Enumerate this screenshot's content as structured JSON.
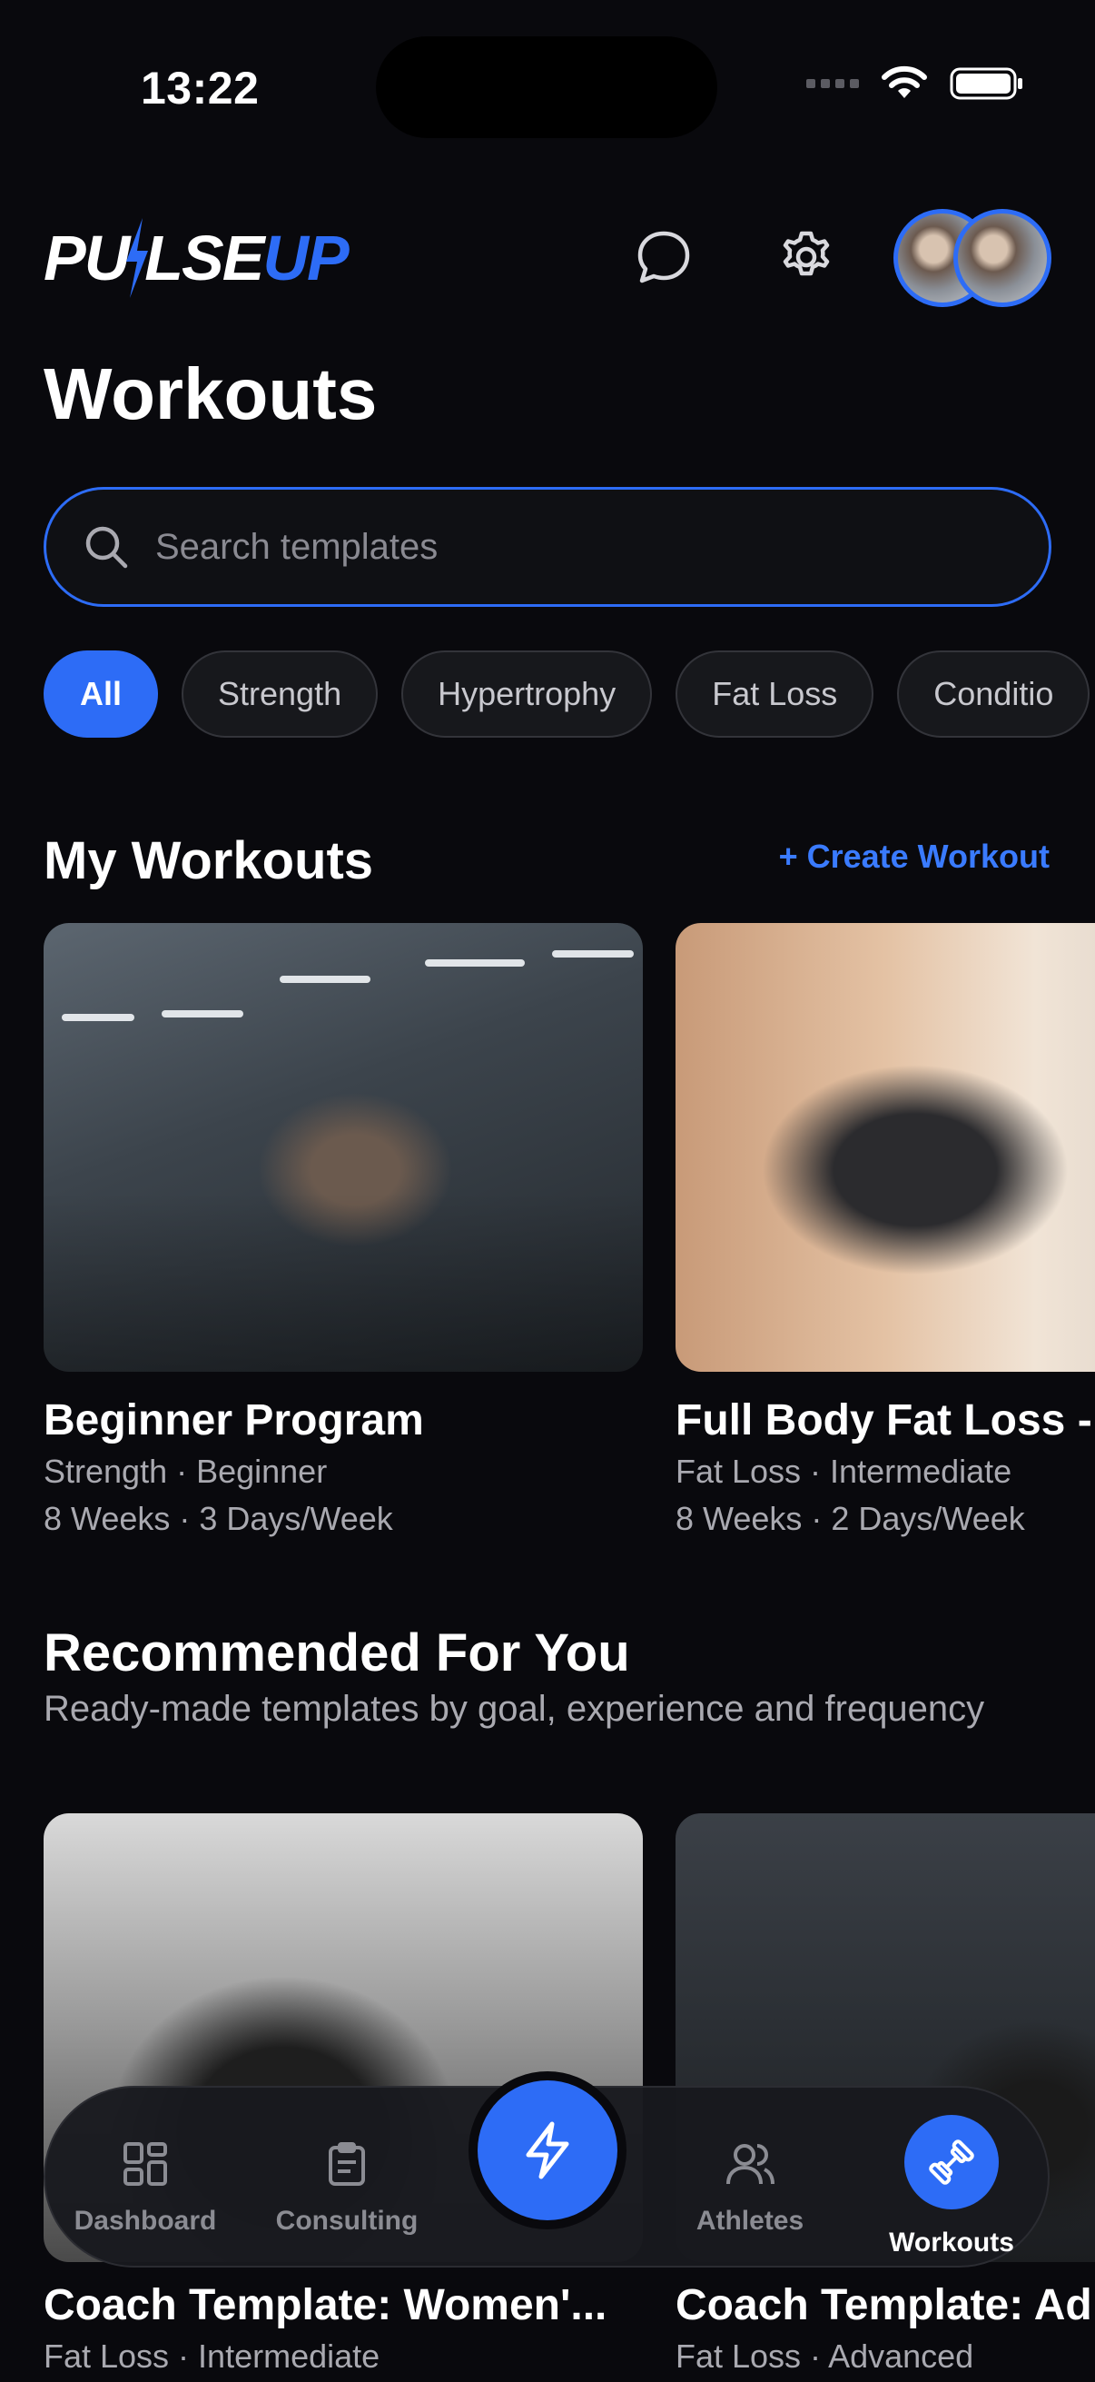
{
  "status_bar": {
    "time": "13:22"
  },
  "header": {
    "logo_left": "PU",
    "logo_mid": "LSE",
    "logo_right": "UP",
    "icons": [
      "chat-bubble-icon",
      "gear-icon"
    ]
  },
  "page": {
    "title": "Workouts"
  },
  "search": {
    "placeholder": "Search templates",
    "value": ""
  },
  "filters": [
    "All",
    "Strength",
    "Hypertrophy",
    "Fat Loss",
    "Conditio"
  ],
  "my_workouts": {
    "title": "My Workouts",
    "create_label": "+ Create Workout",
    "cards": [
      {
        "title": "Beginner Program",
        "meta1": "Strength · Beginner",
        "meta2": "8 Weeks · 3 Days/Week"
      },
      {
        "title": "Full Body Fat Loss -",
        "meta1": "Fat Loss · Intermediate",
        "meta2": "8 Weeks · 2 Days/Week"
      }
    ]
  },
  "recommended": {
    "title": "Recommended For You",
    "subtitle": "Ready-made templates by goal, experience and frequency",
    "cards": [
      {
        "title": "Coach Template: Women'...",
        "meta1": "Fat Loss · Intermediate"
      },
      {
        "title": "Coach Template: Ad",
        "meta1": "Fat Loss · Advanced"
      }
    ]
  },
  "nav": {
    "items": [
      {
        "label": "Dashboard",
        "icon": "grid-icon"
      },
      {
        "label": "Consulting",
        "icon": "clipboard-icon"
      },
      {
        "label": "Athletes",
        "icon": "users-icon"
      },
      {
        "label": "Workouts",
        "icon": "dumbbell-icon"
      }
    ],
    "active": "Workouts",
    "center_icon": "lightning-icon"
  },
  "colors": {
    "accent": "#2d6cf6",
    "background": "#09090d",
    "link": "#3a7bff"
  }
}
